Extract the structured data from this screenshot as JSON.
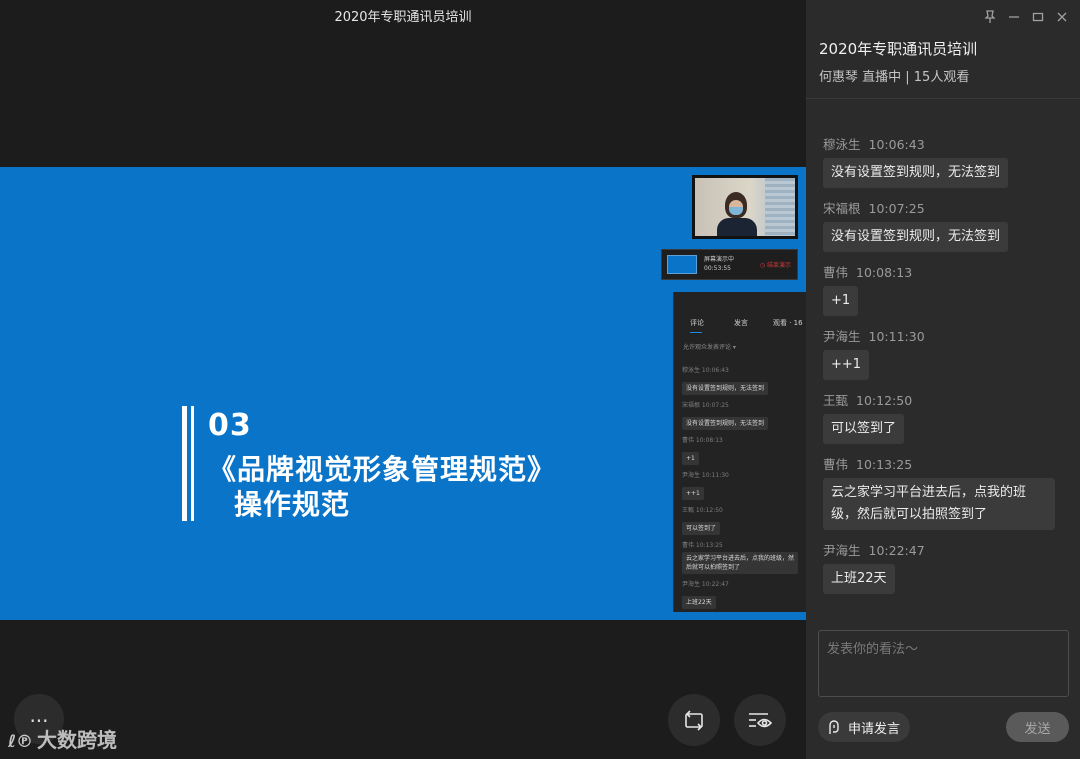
{
  "window": {
    "title": "2020年专职通讯员培训"
  },
  "slide": {
    "number": "03",
    "title": "《品牌视觉形象管理规范》",
    "subtitle": "操作规范"
  },
  "share_bar": {
    "status": "屏幕演示中",
    "timer": "00:53:55",
    "stop": "结束演示"
  },
  "mini_panel": {
    "tabs": [
      "评论",
      "发言",
      "观看 · 16"
    ],
    "allow_label": "允许观众发表评论 ▾",
    "messages": [
      {
        "meta": "穆泳生  10:06:43",
        "text": "没有设置签到规则，无法签到"
      },
      {
        "meta": "宋福根  10:07:25",
        "text": "没有设置签到规则，无法签到"
      },
      {
        "meta": "曹伟  10:08:13",
        "text": "+1"
      },
      {
        "meta": "尹海生  10:11:30",
        "text": "++1"
      },
      {
        "meta": "王甄  10:12:50",
        "text": "可以签到了"
      },
      {
        "meta": "曹伟  10:13:25",
        "text": "云之家学习平台进去后，点我的班级，然后就可以拍照签到了"
      },
      {
        "meta": "尹海生  10:22:47",
        "text": "上班22天"
      }
    ]
  },
  "controls": {
    "more": "...",
    "watermark": "大数跨境"
  },
  "panel": {
    "title": "2020年专职通讯员培训",
    "info": "何惠琴 直播中 | 15人观看",
    "messages": [
      {
        "name": "穆泳生",
        "time": "10:06:43",
        "text": "没有设置签到规则，无法签到"
      },
      {
        "name": "宋福根",
        "time": "10:07:25",
        "text": "没有设置签到规则，无法签到"
      },
      {
        "name": "曹伟",
        "time": "10:08:13",
        "text": "+1"
      },
      {
        "name": "尹海生",
        "time": "10:11:30",
        "text": "++1"
      },
      {
        "name": "王甄",
        "time": "10:12:50",
        "text": "可以签到了"
      },
      {
        "name": "曹伟",
        "time": "10:13:25",
        "text": "云之家学习平台进去后，点我的班级，然后就可以拍照签到了"
      },
      {
        "name": "尹海生",
        "time": "10:22:47",
        "text": "上班22天"
      }
    ],
    "input_placeholder": "发表你的看法～",
    "apply_label": "申请发言",
    "send_label": "发送"
  }
}
